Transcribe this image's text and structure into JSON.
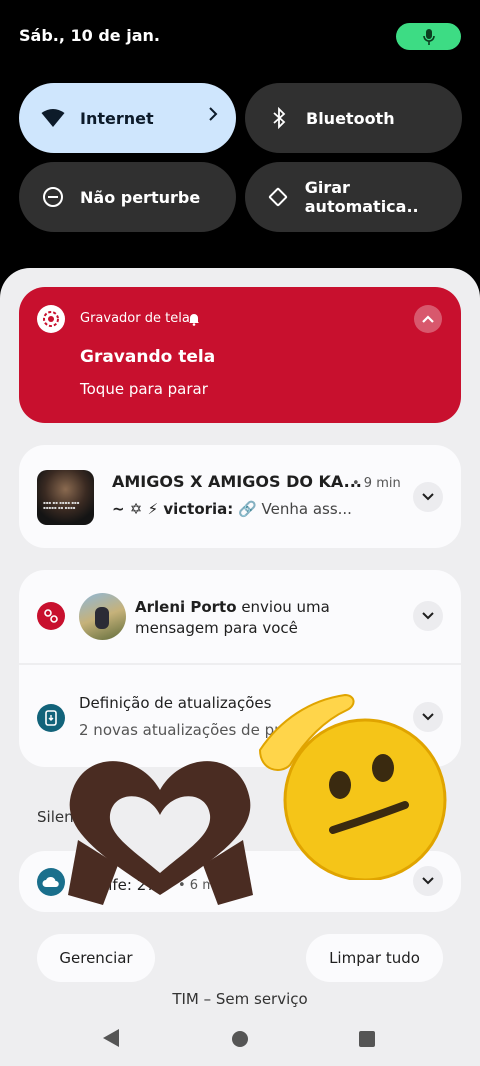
{
  "status": {
    "date": "Sáb., 10 de jan."
  },
  "tiles": [
    {
      "label": "Internet",
      "icon": "wifi-icon",
      "active": true
    },
    {
      "label": "Bluetooth",
      "icon": "bluetooth-icon",
      "active": false
    },
    {
      "label": "Não perturbe",
      "icon": "dnd-icon",
      "active": false
    },
    {
      "label": "Girar automatica..",
      "icon": "rotate-icon",
      "active": false
    }
  ],
  "recorder": {
    "app": "Gravador de tela",
    "title": "Gravando tela",
    "subtitle": "Toque para parar"
  },
  "whatsapp": {
    "title": "AMIGOS X AMIGOS DO KA...",
    "time": "• 9 min",
    "sender": "~ ✡ ⚡ victoria:",
    "message": "🔗 Venha ass..."
  },
  "facebook": {
    "name": "Arleni Porto",
    "text": " enviou uma mensagem para você"
  },
  "update": {
    "title": "Definição de atualizações",
    "subtitle": "2 novas atualizações de pr"
  },
  "section": {
    "silent": "Silenciosas"
  },
  "weather": {
    "text": "Recife: 27°",
    "time": "• 6 min"
  },
  "actions": {
    "manage": "Gerenciar",
    "clear": "Limpar tudo"
  },
  "carrier": "TIM – Sem serviço",
  "colors": {
    "recorder": "#c8102e",
    "internet_tile": "#cfe6fd",
    "mic": "#3ddc84"
  }
}
